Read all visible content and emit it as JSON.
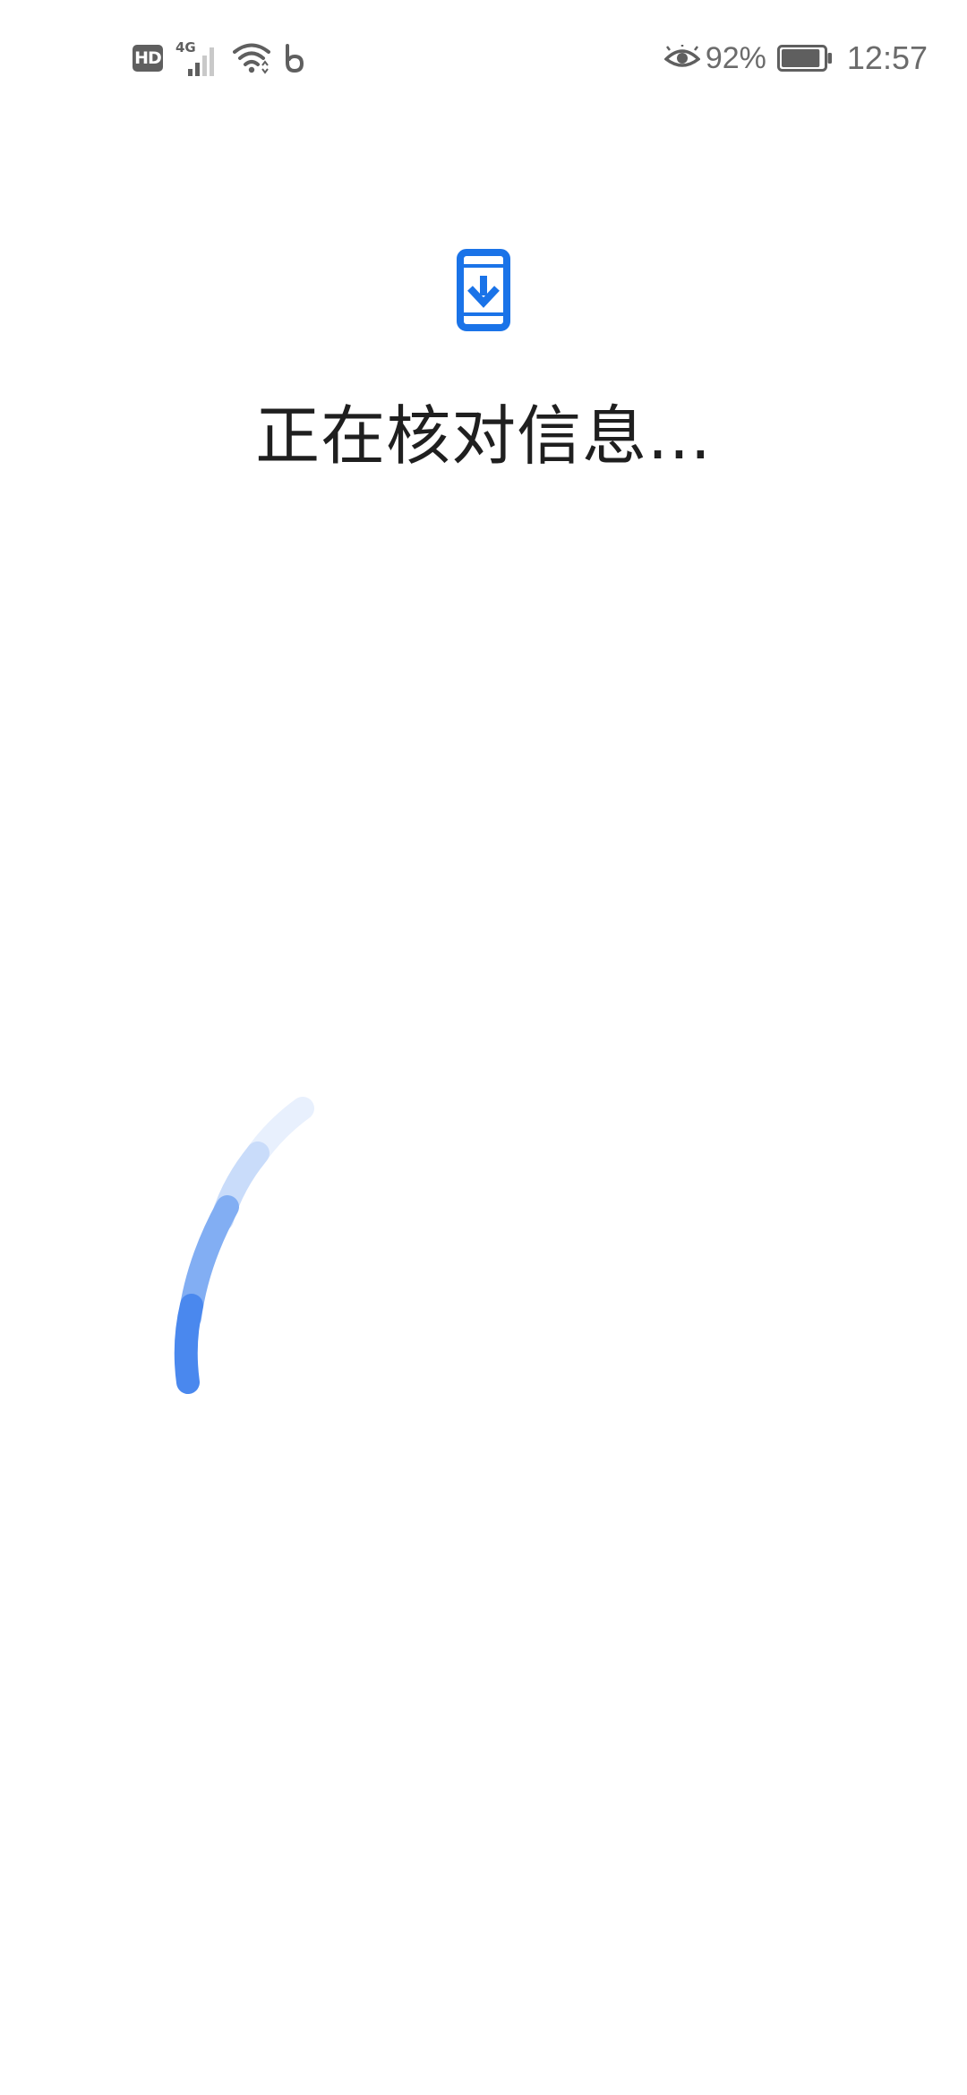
{
  "status_bar": {
    "hd_label": "HD",
    "network_label": "4G",
    "battery_percent": "92%",
    "time": "12:57",
    "battery_level": 0.92,
    "icons": [
      "hd-icon",
      "signal-icon",
      "wifi-icon",
      "app-notification-icon",
      "eye-comfort-icon",
      "battery-icon"
    ]
  },
  "main": {
    "icon": "phone-download-icon",
    "title": "正在核对信息...",
    "loading": true
  },
  "colors": {
    "accent": "#1a73e8",
    "spinner": "#4285f4",
    "text": "#1f1f1f",
    "status_text": "#6b6b6b",
    "background": "#ffffff"
  }
}
